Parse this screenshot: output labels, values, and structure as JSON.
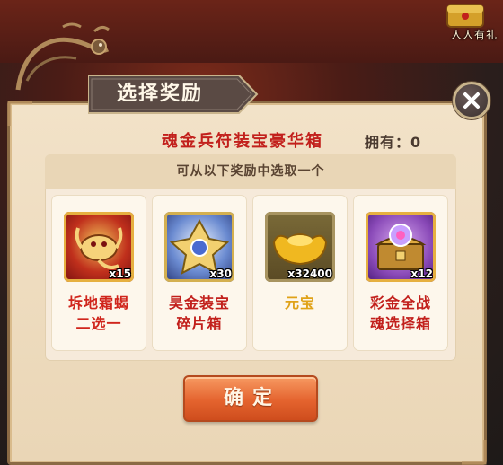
{
  "dialog": {
    "title": "选择奖励",
    "box_name": "魂金兵符装宝豪华箱",
    "owned_label": "拥有：",
    "owned_count": "0",
    "instruction": "可从以下奖励中选取一个",
    "confirm_label": "确定"
  },
  "background": {
    "event_badge_label": "人人有礼"
  },
  "rewards": [
    {
      "name_line1": "坼地霜蝎",
      "name_line2": "二选一",
      "count": "x15",
      "name_color": "#d0251c",
      "icon": "scorpion-shard-icon"
    },
    {
      "name_line1": "昊金装宝",
      "name_line2": "碎片箱",
      "count": "x30",
      "name_color": "#c2201c",
      "icon": "gold-equipment-fragment-icon"
    },
    {
      "name_line1": "元宝",
      "name_line2": "",
      "count": "x32400",
      "name_color": "#e0a218",
      "icon": "gold-ingot-icon"
    },
    {
      "name_line1": "彩金全战",
      "name_line2": "魂选择箱",
      "count": "x12",
      "name_color": "#c2201c",
      "icon": "treasure-chest-icon"
    }
  ],
  "colors": {
    "title_red": "#c2201c",
    "button_orange": "#e4632e",
    "panel_bg": "#f2e2c8"
  }
}
